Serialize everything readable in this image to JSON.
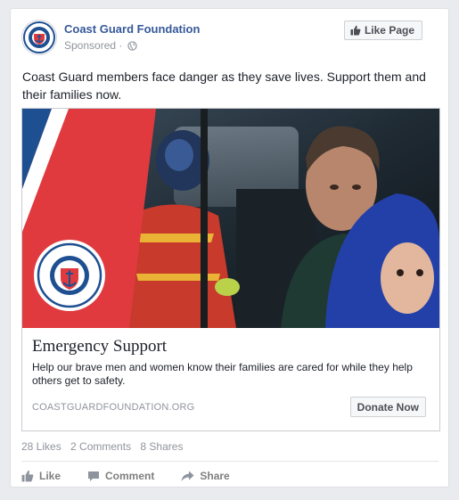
{
  "post": {
    "page_name": "Coast Guard Foundation",
    "sponsored_label": "Sponsored ·",
    "like_page_label": "Like Page",
    "text": "Coast Guard members face danger as they save lives. Support them and their families now."
  },
  "attachment": {
    "logo_text": "COAST GUARD FOUNDATION",
    "title": "Emergency Support",
    "description": "Help our brave men and women know their families are cared for while they help others get to safety.",
    "domain": "COASTGUARDFOUNDATION.ORG",
    "cta_label": "Donate Now"
  },
  "stats": {
    "likes": "28 Likes",
    "comments": "2 Comments",
    "shares": "8 Shares"
  },
  "actions": {
    "like": "Like",
    "comment": "Comment",
    "share": "Share"
  },
  "colors": {
    "brand_blue": "#365899",
    "coast_guard_red": "#e03a3e",
    "coast_guard_blue": "#1d4f91"
  },
  "icons": [
    "globe-icon",
    "thumbs-up-icon",
    "comment-icon",
    "share-icon",
    "coast-guard-emblem"
  ]
}
